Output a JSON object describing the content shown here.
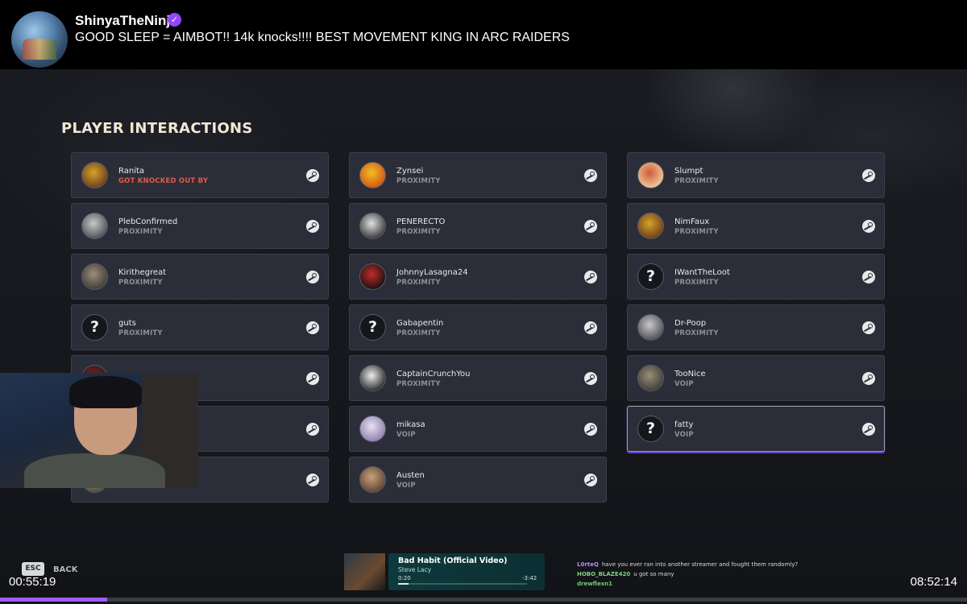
{
  "stream": {
    "streamer_name": "ShinyaTheNinja",
    "title": "GOOD SLEEP = AIMBOT!! 14k knocks!!!! BEST MOVEMENT KING IN ARC RAIDERS"
  },
  "page": {
    "title": "PLAYER INTERACTIONS"
  },
  "columns": [
    [
      {
        "name": "Ranita",
        "type": "GOT KNOCKED OUT BY",
        "avatar": "image",
        "type_color": "#e05a4b"
      },
      {
        "name": "PlebConfirmed",
        "type": "PROXIMITY",
        "avatar": "image"
      },
      {
        "name": "Kirithegreat",
        "type": "PROXIMITY",
        "avatar": "image"
      },
      {
        "name": "guts",
        "type": "PROXIMITY",
        "avatar": "unknown"
      },
      {
        "name": "",
        "type": "",
        "avatar": "image"
      },
      {
        "name": "",
        "type": "",
        "avatar": "image"
      },
      {
        "name": "",
        "type": "",
        "avatar": "image"
      }
    ],
    [
      {
        "name": "Zynsei",
        "type": "PROXIMITY",
        "avatar": "image"
      },
      {
        "name": "PENERECTO",
        "type": "PROXIMITY",
        "avatar": "image"
      },
      {
        "name": "JohnnyLasagna24",
        "type": "PROXIMITY",
        "avatar": "image"
      },
      {
        "name": "Gabapentin",
        "type": "PROXIMITY",
        "avatar": "unknown"
      },
      {
        "name": "CaptainCrunchYou",
        "type": "PROXIMITY",
        "avatar": "image"
      },
      {
        "name": "mikasa",
        "type": "VOIP",
        "avatar": "image"
      },
      {
        "name": "Austen",
        "type": "VOIP",
        "avatar": "image"
      }
    ],
    [
      {
        "name": "Slumpt",
        "type": "PROXIMITY",
        "avatar": "image"
      },
      {
        "name": "NimFaux",
        "type": "PROXIMITY",
        "avatar": "image"
      },
      {
        "name": "IWantTheLoot",
        "type": "PROXIMITY",
        "avatar": "unknown"
      },
      {
        "name": "Dr-Poop",
        "type": "PROXIMITY",
        "avatar": "image"
      },
      {
        "name": "TooNice",
        "type": "VOIP",
        "avatar": "image"
      },
      {
        "name": "fatty",
        "type": "VOIP",
        "avatar": "unknown",
        "selected": true
      }
    ]
  ],
  "footer": {
    "esc_key": "ESC",
    "back_label": "BACK",
    "time_elapsed": "00:55:19",
    "time_total": "08:52:14",
    "video_progress": 0.111
  },
  "music": {
    "title": "Bad Habit (Official Video)",
    "artist": "Steve Lacy",
    "elapsed": "0:20",
    "remaining": "-3:42",
    "progress": 0.08
  },
  "chat": [
    {
      "user": "L0rteQ",
      "text": "have you ever ran into another streamer and fought them randomly?",
      "color": "#b98cff"
    },
    {
      "user": "HOBO_BLAZE420",
      "text": "u got so many",
      "color": "#7fd37f"
    },
    {
      "user": "drewflexn1",
      "text": "",
      "color": "#6fcf6f"
    }
  ],
  "colors": {
    "accent": "#9f5cf7",
    "card_bg": "#2b2e38",
    "alert_red": "#e05a4b"
  },
  "icons": {
    "steam": "steam-icon",
    "unknown_avatar": "question-mark-avatar-icon",
    "verified": "verified-badge-icon"
  }
}
